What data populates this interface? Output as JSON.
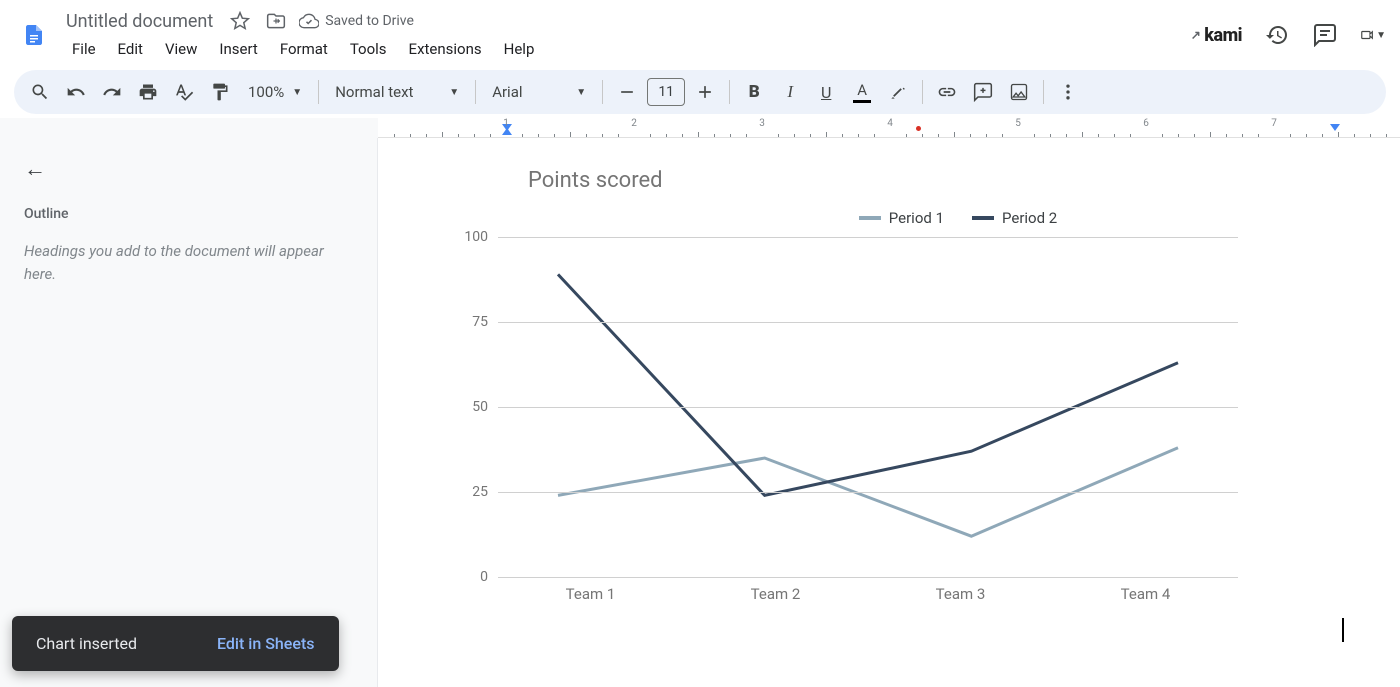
{
  "header": {
    "title": "Untitled document",
    "saved_label": "Saved to Drive",
    "menus": [
      "File",
      "Edit",
      "View",
      "Insert",
      "Format",
      "Tools",
      "Extensions",
      "Help"
    ],
    "kami_label": "kami"
  },
  "toolbar": {
    "zoom": "100%",
    "style": "Normal text",
    "font": "Arial",
    "font_size": "11"
  },
  "sidebar": {
    "outline_title": "Outline",
    "outline_hint": "Headings you add to the document will appear here."
  },
  "toast": {
    "message": "Chart inserted",
    "action": "Edit in Sheets"
  },
  "ruler": {
    "numbers": [
      1,
      2,
      3,
      4,
      5,
      6,
      7
    ]
  },
  "chart_data": {
    "type": "line",
    "title": "Points scored",
    "categories": [
      "Team 1",
      "Team 2",
      "Team 3",
      "Team 4"
    ],
    "series": [
      {
        "name": "Period 1",
        "color": "#8fa8b8",
        "values": [
          24,
          35,
          12,
          38
        ]
      },
      {
        "name": "Period 2",
        "color": "#36485f",
        "values": [
          89,
          24,
          37,
          63
        ]
      }
    ],
    "ylim": [
      0,
      100
    ],
    "yticks": [
      0,
      25,
      50,
      75,
      100
    ],
    "xlabel": "",
    "ylabel": ""
  }
}
